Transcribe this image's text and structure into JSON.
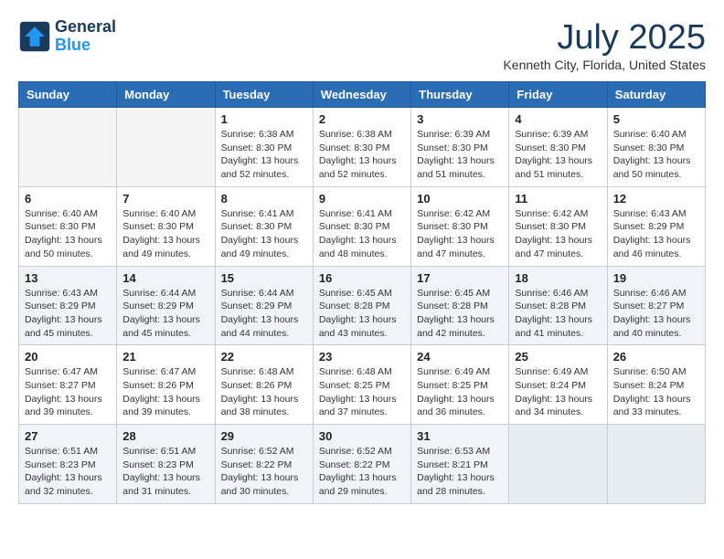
{
  "header": {
    "logo_line1": "General",
    "logo_line2": "Blue",
    "month_title": "July 2025",
    "location": "Kenneth City, Florida, United States"
  },
  "weekdays": [
    "Sunday",
    "Monday",
    "Tuesday",
    "Wednesday",
    "Thursday",
    "Friday",
    "Saturday"
  ],
  "weeks": [
    [
      {
        "day": "",
        "info": ""
      },
      {
        "day": "",
        "info": ""
      },
      {
        "day": "1",
        "info": "Sunrise: 6:38 AM\nSunset: 8:30 PM\nDaylight: 13 hours and 52 minutes."
      },
      {
        "day": "2",
        "info": "Sunrise: 6:38 AM\nSunset: 8:30 PM\nDaylight: 13 hours and 52 minutes."
      },
      {
        "day": "3",
        "info": "Sunrise: 6:39 AM\nSunset: 8:30 PM\nDaylight: 13 hours and 51 minutes."
      },
      {
        "day": "4",
        "info": "Sunrise: 6:39 AM\nSunset: 8:30 PM\nDaylight: 13 hours and 51 minutes."
      },
      {
        "day": "5",
        "info": "Sunrise: 6:40 AM\nSunset: 8:30 PM\nDaylight: 13 hours and 50 minutes."
      }
    ],
    [
      {
        "day": "6",
        "info": "Sunrise: 6:40 AM\nSunset: 8:30 PM\nDaylight: 13 hours and 50 minutes."
      },
      {
        "day": "7",
        "info": "Sunrise: 6:40 AM\nSunset: 8:30 PM\nDaylight: 13 hours and 49 minutes."
      },
      {
        "day": "8",
        "info": "Sunrise: 6:41 AM\nSunset: 8:30 PM\nDaylight: 13 hours and 49 minutes."
      },
      {
        "day": "9",
        "info": "Sunrise: 6:41 AM\nSunset: 8:30 PM\nDaylight: 13 hours and 48 minutes."
      },
      {
        "day": "10",
        "info": "Sunrise: 6:42 AM\nSunset: 8:30 PM\nDaylight: 13 hours and 47 minutes."
      },
      {
        "day": "11",
        "info": "Sunrise: 6:42 AM\nSunset: 8:30 PM\nDaylight: 13 hours and 47 minutes."
      },
      {
        "day": "12",
        "info": "Sunrise: 6:43 AM\nSunset: 8:29 PM\nDaylight: 13 hours and 46 minutes."
      }
    ],
    [
      {
        "day": "13",
        "info": "Sunrise: 6:43 AM\nSunset: 8:29 PM\nDaylight: 13 hours and 45 minutes."
      },
      {
        "day": "14",
        "info": "Sunrise: 6:44 AM\nSunset: 8:29 PM\nDaylight: 13 hours and 45 minutes."
      },
      {
        "day": "15",
        "info": "Sunrise: 6:44 AM\nSunset: 8:29 PM\nDaylight: 13 hours and 44 minutes."
      },
      {
        "day": "16",
        "info": "Sunrise: 6:45 AM\nSunset: 8:28 PM\nDaylight: 13 hours and 43 minutes."
      },
      {
        "day": "17",
        "info": "Sunrise: 6:45 AM\nSunset: 8:28 PM\nDaylight: 13 hours and 42 minutes."
      },
      {
        "day": "18",
        "info": "Sunrise: 6:46 AM\nSunset: 8:28 PM\nDaylight: 13 hours and 41 minutes."
      },
      {
        "day": "19",
        "info": "Sunrise: 6:46 AM\nSunset: 8:27 PM\nDaylight: 13 hours and 40 minutes."
      }
    ],
    [
      {
        "day": "20",
        "info": "Sunrise: 6:47 AM\nSunset: 8:27 PM\nDaylight: 13 hours and 39 minutes."
      },
      {
        "day": "21",
        "info": "Sunrise: 6:47 AM\nSunset: 8:26 PM\nDaylight: 13 hours and 39 minutes."
      },
      {
        "day": "22",
        "info": "Sunrise: 6:48 AM\nSunset: 8:26 PM\nDaylight: 13 hours and 38 minutes."
      },
      {
        "day": "23",
        "info": "Sunrise: 6:48 AM\nSunset: 8:25 PM\nDaylight: 13 hours and 37 minutes."
      },
      {
        "day": "24",
        "info": "Sunrise: 6:49 AM\nSunset: 8:25 PM\nDaylight: 13 hours and 36 minutes."
      },
      {
        "day": "25",
        "info": "Sunrise: 6:49 AM\nSunset: 8:24 PM\nDaylight: 13 hours and 34 minutes."
      },
      {
        "day": "26",
        "info": "Sunrise: 6:50 AM\nSunset: 8:24 PM\nDaylight: 13 hours and 33 minutes."
      }
    ],
    [
      {
        "day": "27",
        "info": "Sunrise: 6:51 AM\nSunset: 8:23 PM\nDaylight: 13 hours and 32 minutes."
      },
      {
        "day": "28",
        "info": "Sunrise: 6:51 AM\nSunset: 8:23 PM\nDaylight: 13 hours and 31 minutes."
      },
      {
        "day": "29",
        "info": "Sunrise: 6:52 AM\nSunset: 8:22 PM\nDaylight: 13 hours and 30 minutes."
      },
      {
        "day": "30",
        "info": "Sunrise: 6:52 AM\nSunset: 8:22 PM\nDaylight: 13 hours and 29 minutes."
      },
      {
        "day": "31",
        "info": "Sunrise: 6:53 AM\nSunset: 8:21 PM\nDaylight: 13 hours and 28 minutes."
      },
      {
        "day": "",
        "info": ""
      },
      {
        "day": "",
        "info": ""
      }
    ]
  ]
}
